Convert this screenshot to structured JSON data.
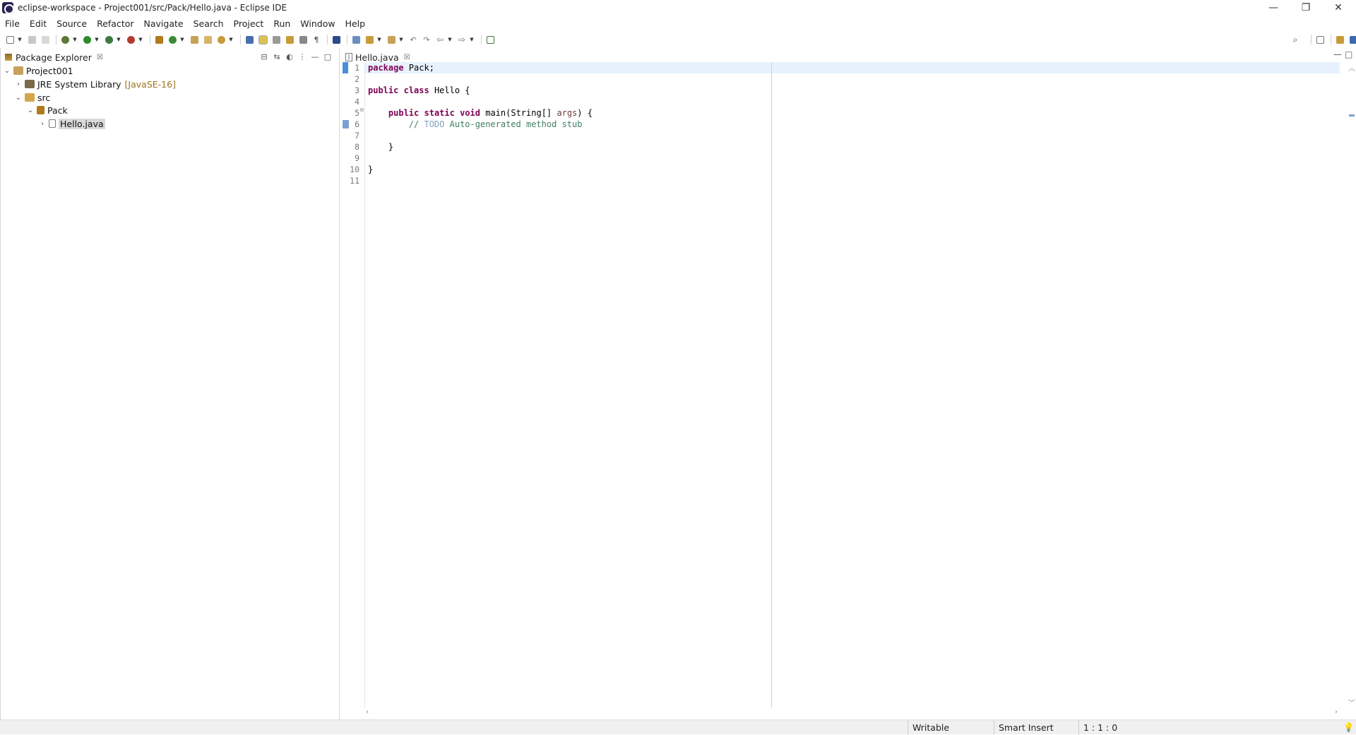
{
  "window": {
    "title": "eclipse-workspace - Project001/src/Pack/Hello.java - Eclipse IDE",
    "controls": {
      "minimize": "—",
      "restore": "❐",
      "close": "✕"
    }
  },
  "menu": [
    "File",
    "Edit",
    "Source",
    "Refactor",
    "Navigate",
    "Search",
    "Project",
    "Run",
    "Window",
    "Help"
  ],
  "package_explorer": {
    "tab_label": "Package Explorer",
    "tab_close": "☒",
    "tree": {
      "project": "Project001",
      "jre": {
        "label": "JRE System Library",
        "decoration": "[JavaSE-16]"
      },
      "src": "src",
      "package": "Pack",
      "file": "Hello.java"
    }
  },
  "editor": {
    "tab_label": "Hello.java",
    "tab_close": "☒",
    "line_numbers": [
      "1",
      "2",
      "3",
      "4",
      "5",
      "6",
      "7",
      "8",
      "9",
      "10",
      "11"
    ],
    "fold_marker": "⊖",
    "lines": {
      "l1_kw": "package",
      "l1_rest": " Pack;",
      "l3_kw1": "public",
      "l3_kw2": "class",
      "l3_rest": " Hello {",
      "l5_kw1": "public",
      "l5_kw2": "static",
      "l5_kw3": "void",
      "l5_mid": " main(String[] ",
      "l5_param": "args",
      "l5_end": ") {",
      "l6_comment_a": "// ",
      "l6_tag": "TODO",
      "l6_comment_b": " Auto-generated method stub",
      "l8": "}",
      "l10": "}"
    }
  },
  "status": {
    "writable": "Writable",
    "insert_mode": "Smart Insert",
    "position": "1 : 1 : 0"
  },
  "colors": {
    "keyword": "#7f0055",
    "comment": "#3f7f5f",
    "current_line": "#e8f2fe",
    "selection": "#d9d9d9"
  }
}
